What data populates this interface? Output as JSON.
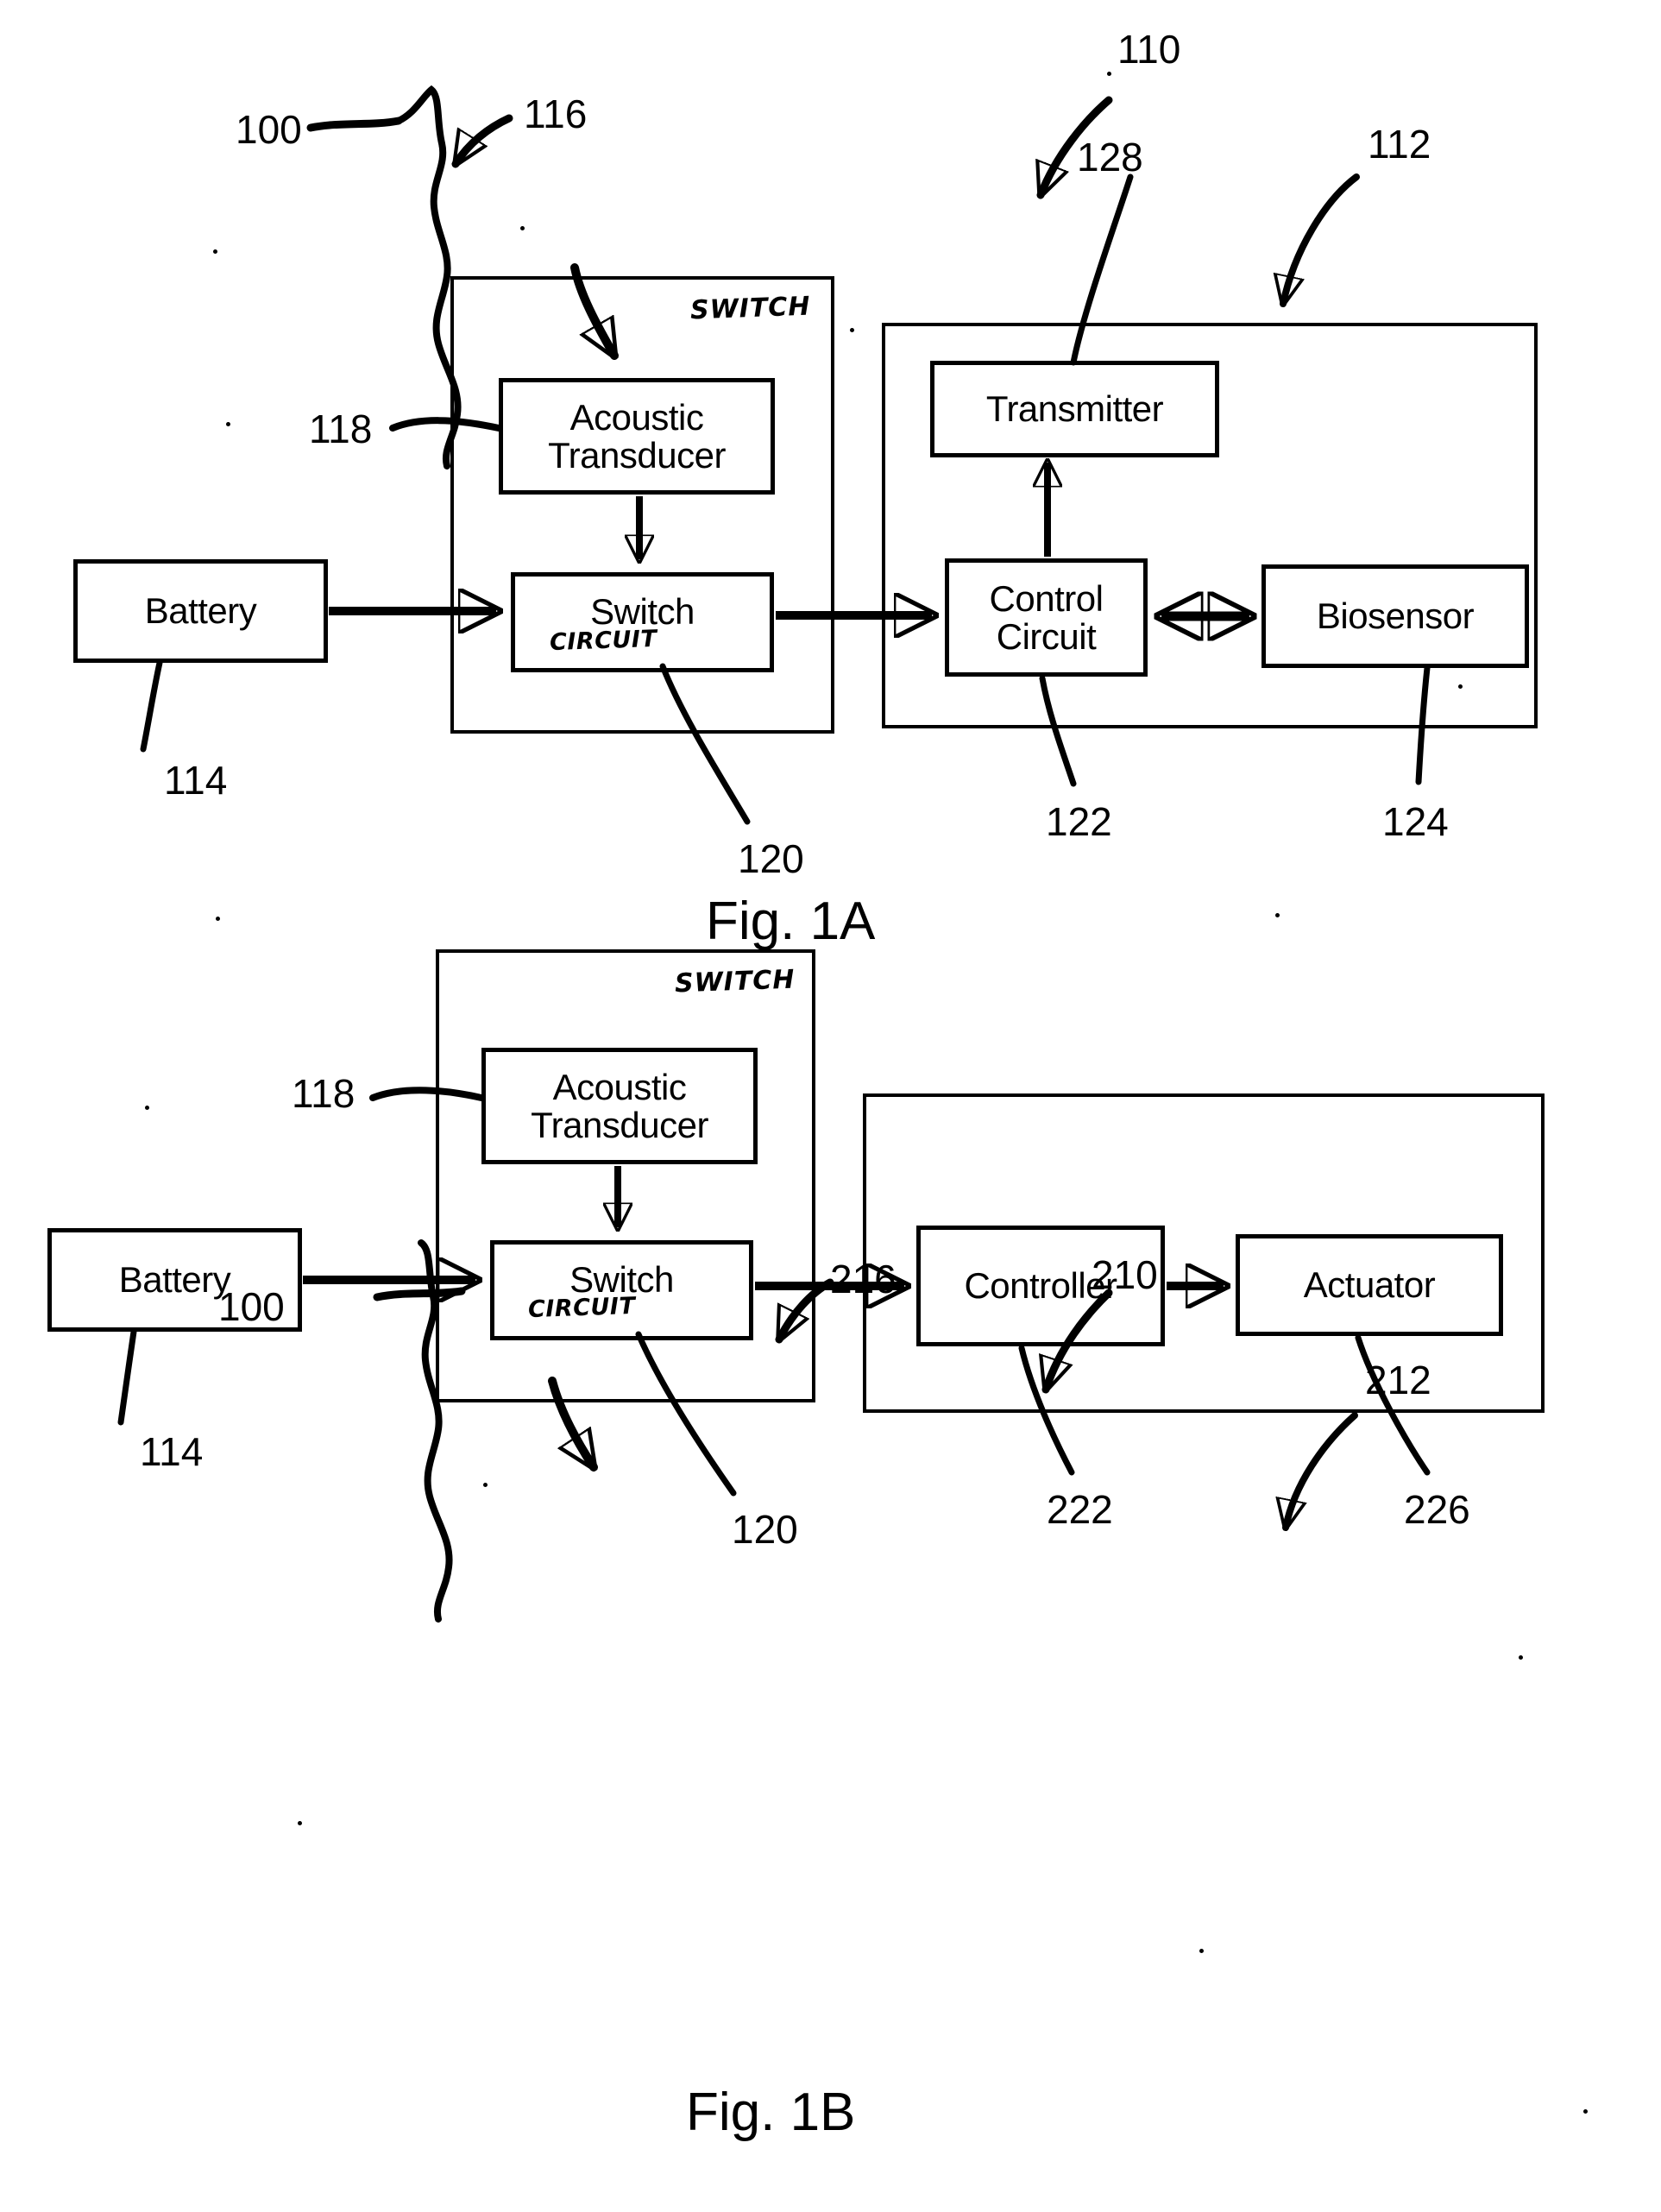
{
  "document": {
    "kind": "patent-drawing-sheet",
    "figures": [
      "Fig. 1A",
      "Fig. 1B"
    ]
  },
  "fig1a": {
    "caption": "Fig. 1A",
    "boxes": {
      "battery": "Battery",
      "acoustic_transducer": "Acoustic\nTransducer",
      "switch": "Switch",
      "transmitter": "Transmitter",
      "control_circuit": "Control\nCircuit",
      "biosensor": "Biosensor"
    },
    "handwritten": {
      "switch_module": "SWITCH",
      "switch_circuit": "CIRCUIT"
    },
    "refs": {
      "r100": "100",
      "r110": "110",
      "r112": "112",
      "r114": "114",
      "r116": "116",
      "r118": "118",
      "r120": "120",
      "r122": "122",
      "r124": "124",
      "r128": "128"
    }
  },
  "fig1b": {
    "caption": "Fig. 1B",
    "boxes": {
      "battery": "Battery",
      "acoustic_transducer": "Acoustic\nTransducer",
      "switch": "Switch",
      "controller": "Controller",
      "actuator": "Actuator"
    },
    "handwritten": {
      "switch_module": "SWITCH",
      "switch_circuit": "CIRCUIT"
    },
    "refs": {
      "r100": "100",
      "r114": "114",
      "r118": "118",
      "r120": "120",
      "r210": "210",
      "r212": "212",
      "r216": "216",
      "r222": "222",
      "r226": "226"
    }
  },
  "colors": {
    "ink": "#000000",
    "paper": "#ffffff"
  }
}
